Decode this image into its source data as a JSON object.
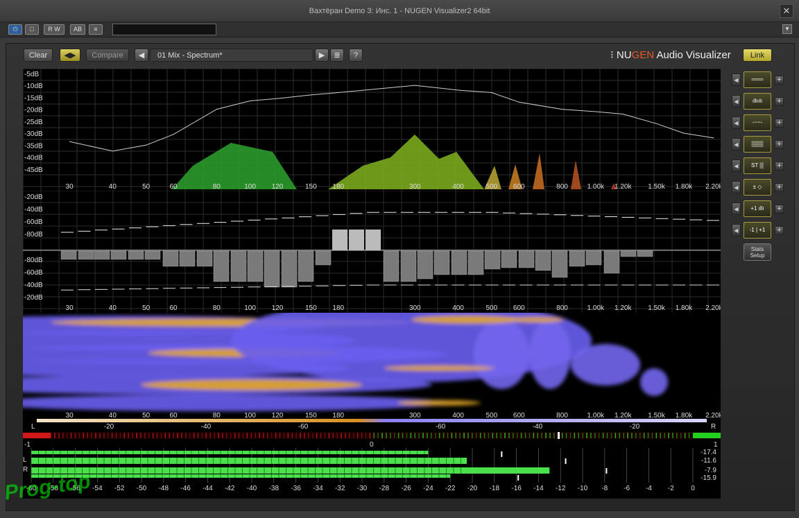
{
  "window": {
    "title": "Вахтёрaн Demo 3: Инс. 1 - NUGEN Visualizer2 64bit",
    "close_label": "✕"
  },
  "host_toolbar": {
    "buttons": [
      {
        "name": "power",
        "label": "⏻"
      },
      {
        "name": "bypass",
        "label": "□"
      },
      {
        "name": "read-write",
        "label": "R W"
      },
      {
        "name": "ab",
        "label": "AB"
      },
      {
        "name": "menu",
        "label": "≡"
      }
    ],
    "preset_field_value": "",
    "dropdown_label": "▼"
  },
  "toolbar": {
    "clear_label": "Clear",
    "link_arrows_label": "◀▶",
    "compare_label": "Compare",
    "prev_label": "◀",
    "preset_name": "01 Mix - Spectrum*",
    "next_label": "▶",
    "list_label": "≣",
    "help_label": "?"
  },
  "brand": {
    "prefix": "⁝ NU",
    "accent": "GEN",
    "suffix": " Audio Visualizer",
    "link_label": "Link",
    "accent_color": "#e35a2a"
  },
  "freq_axis": [
    "30",
    "40",
    "50",
    "60",
    "80",
    "100",
    "120",
    "150",
    "180",
    "300",
    "400",
    "500",
    "600",
    "800",
    "1.00k",
    "1.20k",
    "1.50k",
    "1.80k",
    "2.20k"
  ],
  "spectrum_db_axis": [
    "-5dB",
    "-10dB",
    "-15dB",
    "-20dB",
    "-25dB",
    "-30dB",
    "-35dB",
    "-40dB",
    "-45dB"
  ],
  "stats_db_axis_top": [
    "-20dB",
    "-40dB",
    "-60dB",
    "-80dB"
  ],
  "stats_db_axis_bottom": [
    "-80dB",
    "-60dB",
    "-40dB",
    "-20dB"
  ],
  "mode_buttons": [
    {
      "name": "spectrum-line",
      "icon": "lines-icon",
      "label": "═══"
    },
    {
      "name": "spectrum-bars",
      "icon": "bars-icon",
      "label": "ıllıılı"
    },
    {
      "name": "spectrum-wave",
      "icon": "wave-icon",
      "label": "-~~-"
    },
    {
      "name": "spectrogram",
      "icon": "grid-icon",
      "label": "▒▒▒"
    },
    {
      "name": "stereo",
      "icon": "stereo-icon",
      "label": "ST ▒"
    },
    {
      "name": "phase",
      "icon": "diamond-icon",
      "label": "± ◇"
    },
    {
      "name": "correlation",
      "icon": "correlation-icon",
      "label": "+1 ıllı"
    },
    {
      "name": "range",
      "icon": "range-icon",
      "label": "-1 | +1"
    }
  ],
  "stats_setup_label": "Stats\nSetup",
  "balance": {
    "left_label": "L",
    "right_label": "R",
    "scale": [
      "-20",
      "-40",
      "-60",
      "-60",
      "-40",
      "-20"
    ],
    "corr_left": "-1",
    "corr_center": "0",
    "corr_right": "1"
  },
  "meters": {
    "scale": [
      "-60",
      "-58",
      "-56",
      "-54",
      "-52",
      "-50",
      "-48",
      "-46",
      "-44",
      "-42",
      "-40",
      "-38",
      "-36",
      "-34",
      "-32",
      "-30",
      "-28",
      "-26",
      "-24",
      "-22",
      "-20",
      "-18",
      "-16",
      "-14",
      "-12",
      "-10",
      "-8",
      "-6",
      "-4",
      "-2",
      "0"
    ],
    "channels": [
      "L",
      "R"
    ],
    "readouts": [
      "-17.4",
      "-11.6",
      "-7.9",
      "-15.9"
    ],
    "levels_db": [
      -24.0,
      -20.5,
      -13.0,
      -22.0
    ]
  },
  "watermark": "Prog-top",
  "chart_data": {
    "type": "area",
    "x_scale": "log",
    "xlim": [
      22,
      2300
    ],
    "ylim": [
      -50,
      -3
    ],
    "x": [
      30,
      40,
      50,
      60,
      80,
      100,
      120,
      150,
      180,
      300,
      400,
      500,
      600,
      800,
      1000,
      1200,
      1500,
      1800,
      2200
    ],
    "series": [
      {
        "values": [
          -33.5,
          -37.5,
          -35,
          -30.5,
          -20,
          -16.5,
          -15.5,
          -14,
          -13,
          -10,
          -12,
          -13,
          -17,
          -20,
          -21,
          -22,
          -26,
          -30,
          -32
        ]
      }
    ]
  }
}
